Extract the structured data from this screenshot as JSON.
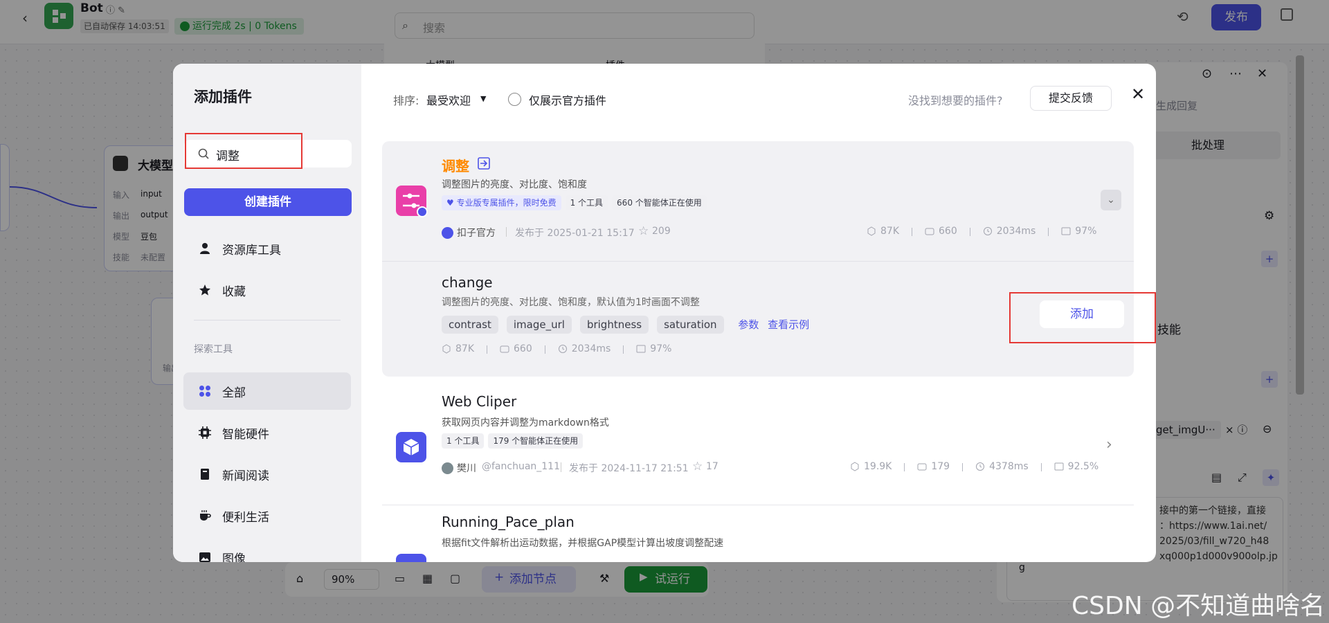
{
  "topbar": {
    "bot_name": "Bot",
    "autosave": "已自动保存 14:03:51",
    "run_status": "运行完成 2s | 0 Tokens",
    "publish_label": "发布"
  },
  "bg_search_placeholder": "搜索",
  "bg_popup_items": [
    "大模型",
    "插件"
  ],
  "bg_node": {
    "title": "大模型",
    "input_label": "输入",
    "input_val": "input",
    "output_label": "输出",
    "output_val": "output",
    "model_label": "模型",
    "model_val": "豆包",
    "skill_label": "技能",
    "skill_val": "未配置"
  },
  "bg_side2": {
    "label": "输出"
  },
  "bottom_toolbar": {
    "zoom": "90%",
    "add_node": "添加节点",
    "test_run": "试运行"
  },
  "right_panel": {
    "subtitle": "提词生成回复",
    "batch": "批处理",
    "skills": "技能",
    "param_tag": "get_imgU···",
    "text_lines": [
      "接中的第一个链接，直接",
      "：https://www.1ai.net/",
      "2025/03/fill_w720_h48",
      "xq000p1d000v900olp.jp",
      "g"
    ]
  },
  "modal": {
    "title": "添加插件",
    "search_value": "调整",
    "create_label": "创建插件",
    "nav": [
      {
        "label": "资源库工具",
        "icon": "person-icon"
      },
      {
        "label": "收藏",
        "icon": "star-icon"
      }
    ],
    "explore_heading": "探索工具",
    "categories": [
      {
        "label": "全部",
        "icon": "grid-icon"
      },
      {
        "label": "智能硬件",
        "icon": "chip-icon"
      },
      {
        "label": "新闻阅读",
        "icon": "book-icon"
      },
      {
        "label": "便利生活",
        "icon": "cup-icon"
      },
      {
        "label": "图像",
        "icon": "image-icon"
      }
    ],
    "sort_label": "排序:",
    "sort_value": "最受欢迎",
    "official_only": "仅展示官方插件",
    "not_found": "没找到想要的插件?",
    "feedback": "提交反馈",
    "plugins": [
      {
        "name": "调整",
        "desc": "调整图片的亮度、对比度、饱和度",
        "tags": [
          "专业版专属插件，限时免费",
          "1 个工具",
          "660 个智能体正在使用"
        ],
        "author": "扣子官方",
        "published": "发布于 2025-01-21 15:17",
        "stars": "209",
        "stats": [
          "87K",
          "660",
          "2034ms",
          "97%"
        ],
        "tool": {
          "name": "change",
          "desc": "调整图片的亮度、对比度、饱和度，默认值为1时画面不调整",
          "params": [
            "contrast",
            "image_url",
            "brightness",
            "saturation"
          ],
          "params_link": "参数",
          "example_link": "查看示例",
          "stats": [
            "87K",
            "660",
            "2034ms",
            "97%"
          ],
          "add_label": "添加"
        }
      },
      {
        "name": "Web Cliper",
        "desc": "获取网页内容并调整为markdown格式",
        "tags": [
          "1 个工具",
          "179 个智能体正在使用"
        ],
        "author": "樊川",
        "handle": "@fanchuan_111",
        "published": "发布于 2024-11-17 21:51",
        "stars": "17",
        "stats": [
          "19.9K",
          "179",
          "4378ms",
          "92.5%"
        ]
      },
      {
        "name": "Running_Pace_plan",
        "desc": "根据fit文件解析出运动数据，并根据GAP模型计算出坡度调整配速"
      }
    ]
  },
  "watermark": "CSDN @不知道曲啥名",
  "colors": {
    "primary": "#4d53e8",
    "accent": "#ff8a00",
    "danger": "#e53935",
    "run_green": "#1a9b3a"
  }
}
